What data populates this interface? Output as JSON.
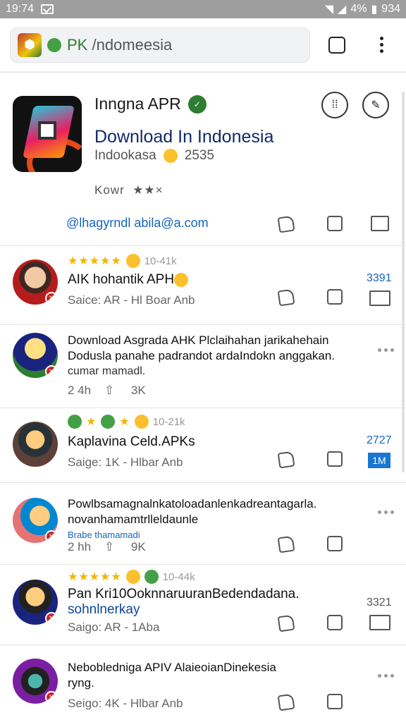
{
  "status_bar": {
    "time": "19:74",
    "battery": "4%",
    "clock_right": "934"
  },
  "browser": {
    "url_prefix": "PK",
    "url_rest": " /ndomeesia"
  },
  "app": {
    "title": "Inngna APR",
    "headline": "Download In Indonesia",
    "meta": "Indookasa",
    "meta_num": "2535",
    "rating_label": "Kowr",
    "rating_stars": "★★×",
    "email": "@lhagyrndl abila@a.com"
  },
  "posts": [
    {
      "rating_stars": "★★★★★",
      "rating_extra": "10-41k",
      "title": "AIK hohantik APH",
      "meta": "Saice:   AR - Hl Boar Anb",
      "num": "3391"
    },
    {
      "body_line1": "Download Asgrada AHK Plclaihahan jarikahehain",
      "body_line2": "Dodusla panahe padrandot ardaIndokn anggakan.",
      "body_line3": "cumar mamadl.",
      "meta_time": "2 4h",
      "meta_count": "3K"
    },
    {
      "rating_extra": "10-21k",
      "title": "Kaplavina Celd.APKs",
      "meta": "Saige:   1K - Hlbar Anb",
      "num": "2727",
      "num_box": "1M"
    },
    {
      "body_line1": "Powlbsamagnalnkatoloadanlenkadreantagarla.",
      "body_line2": "novanhamamtrlleldaunle",
      "body_line3": "Brabe thamamadi",
      "meta_time": "2 hh",
      "meta_count": "9K"
    },
    {
      "rating_stars": "★★★★★",
      "rating_extra": "10-44k",
      "title": "Pan Kri10OoknnaruuranBedendadana.",
      "title2": "sohnlnerkay",
      "meta": "Saigo:   AR - 1Aba",
      "num": "3321"
    },
    {
      "body_line1": "Nebobledniga APIV AlaieoianDinekesia",
      "body_line2": "ryng.",
      "meta": "Seigo:   4K - Hlbar Anb"
    }
  ]
}
